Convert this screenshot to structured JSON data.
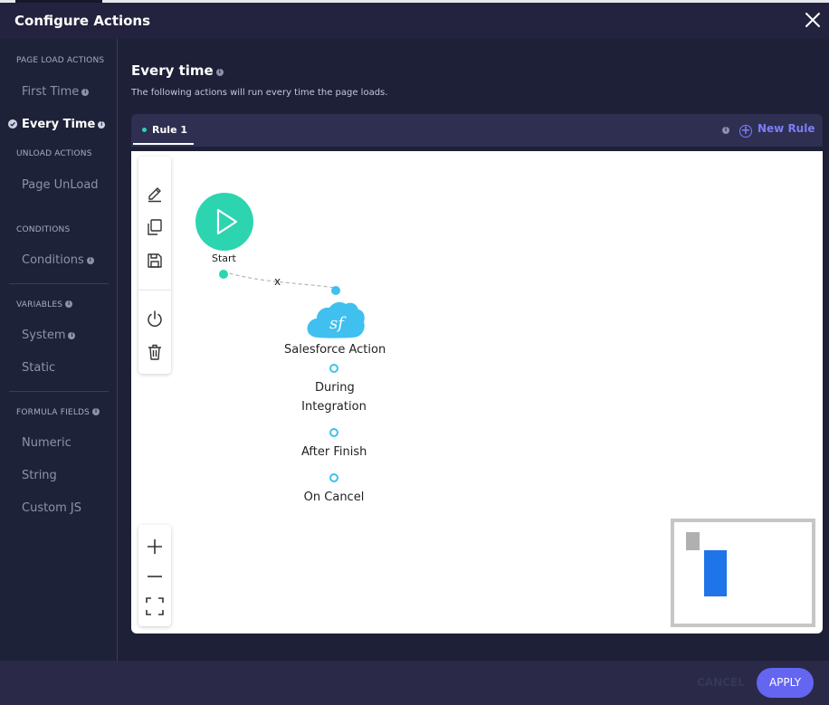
{
  "header": {
    "title": "Configure Actions"
  },
  "sidebar": {
    "page_load_section": "PAGE LOAD ACTIONS",
    "first_time": "First Time",
    "every_time": "Every Time",
    "unload_section": "UNLOAD ACTIONS",
    "page_unload": "Page UnLoad",
    "conditions_section": "CONDITIONS",
    "conditions": "Conditions",
    "variables_section": "VARIABLES",
    "system": "System",
    "static": "Static",
    "formula_section": "FORMULA FIELDS",
    "numeric": "Numeric",
    "string": "String",
    "custom_js": "Custom JS"
  },
  "main": {
    "title": "Every time",
    "subtitle": "The following actions will run every time the page loads.",
    "rule_tab": "Rule 1",
    "new_rule": "New Rule"
  },
  "flow": {
    "start_label": "Start",
    "edge_label": "x",
    "action_label": "Salesforce Action",
    "action_icon_text": "sf",
    "during_line1": "During",
    "during_line2": "Integration",
    "after_finish": "After Finish",
    "on_cancel": "On Cancel"
  },
  "footer": {
    "cancel": "CANCEL",
    "apply": "APPLY"
  },
  "colors": {
    "accent": "#6466f1",
    "start_node": "#2dd4b0",
    "salesforce": "#3fc0ee",
    "minimap_node": "#1e74e8"
  }
}
